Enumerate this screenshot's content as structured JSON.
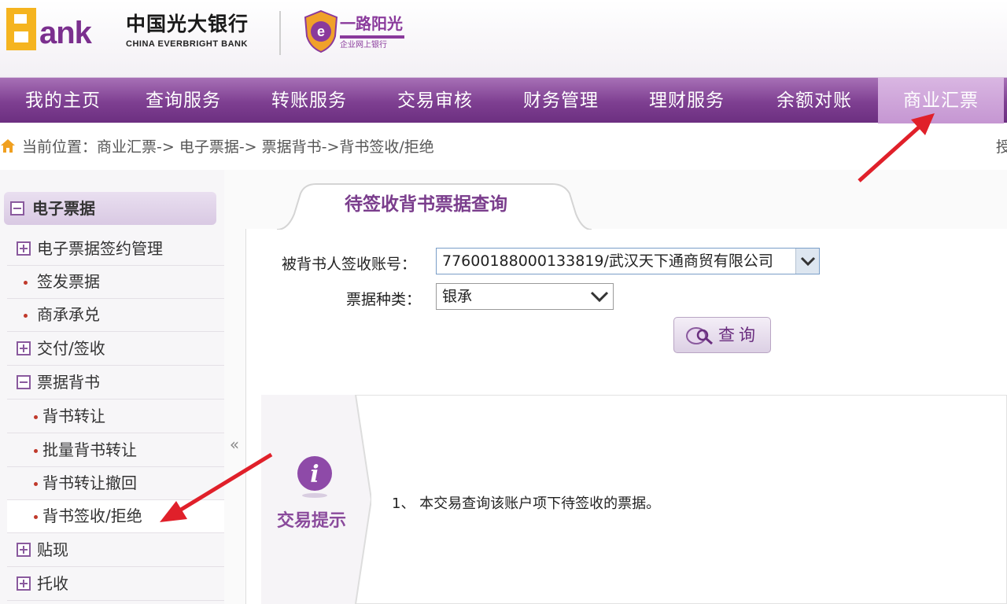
{
  "header": {
    "logo_b": "B",
    "logo_rest": "ank",
    "bank_name_cn": "中国光大银行",
    "bank_name_en": "CHINA EVERBRIGHT BANK",
    "slogan": "一路阳光",
    "slogan_sub": "企业网上银行"
  },
  "nav": {
    "items": [
      {
        "label": "我的主页"
      },
      {
        "label": "查询服务"
      },
      {
        "label": "转账服务"
      },
      {
        "label": "交易审核"
      },
      {
        "label": "财务管理"
      },
      {
        "label": "理财服务"
      },
      {
        "label": "余额对账"
      },
      {
        "label": "商业汇票"
      }
    ],
    "active_index": 7,
    "colors": {
      "bar": "#7e3f91",
      "active": "#c596d2"
    }
  },
  "breadcrumb": {
    "text": "当前位置：商业汇票-> 电子票据-> 票据背书->背书签收/拒绝",
    "right_glyph": "授"
  },
  "sidebar": {
    "header": "电子票据",
    "items": [
      {
        "label": "电子票据签约管理"
      },
      {
        "label": "签发票据"
      },
      {
        "label": "商承承兑"
      },
      {
        "label": "交付/签收"
      },
      {
        "label": "票据背书"
      },
      {
        "label": "背书转让"
      },
      {
        "label": "批量背书转让"
      },
      {
        "label": "背书转让撤回"
      },
      {
        "label": "背书签收/拒绝"
      },
      {
        "label": "贴现"
      },
      {
        "label": "托收"
      }
    ],
    "collapse_label": "«"
  },
  "form": {
    "tab_title": "待签收背书票据查询",
    "account_label": "被背书人签收账号：",
    "account_value": "77600188000133819/武汉天下通商贸有限公司",
    "kind_label": "票据种类：",
    "kind_value": "银承",
    "query_button": "查询"
  },
  "tips": {
    "title": "交易提示",
    "items": [
      "1、 本交易查询该账户项下待签收的票据。"
    ]
  },
  "accent_color": "#7a3d8c",
  "annotation_color": "#e0202a"
}
